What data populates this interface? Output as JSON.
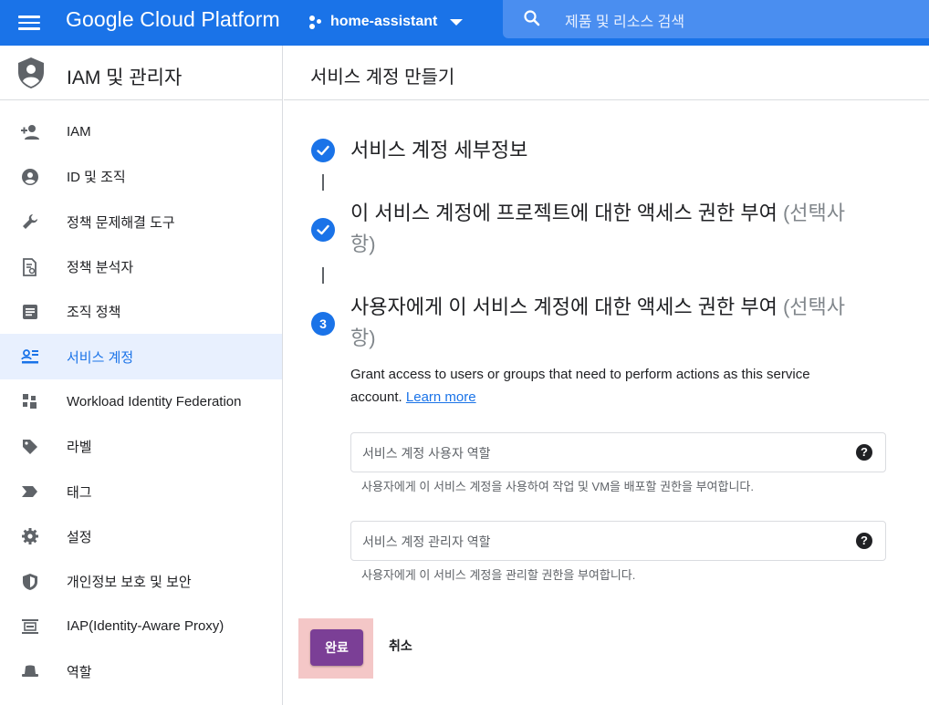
{
  "topbar": {
    "brand": "Google Cloud Platform",
    "project": "home-assistant",
    "search_placeholder": "제품 및 리소스 검색",
    "accent_color": "#1a73e8"
  },
  "sidebar": {
    "title": "IAM 및 관리자",
    "items": [
      {
        "label": "IAM",
        "icon": "person-add-icon",
        "active": false
      },
      {
        "label": "ID 및 조직",
        "icon": "account-circle-icon",
        "active": false
      },
      {
        "label": "정책 문제해결 도구",
        "icon": "wrench-icon",
        "active": false
      },
      {
        "label": "정책 분석자",
        "icon": "document-search-icon",
        "active": false
      },
      {
        "label": "조직 정책",
        "icon": "list-document-icon",
        "active": false
      },
      {
        "label": "서비스 계정",
        "icon": "service-account-icon",
        "active": true
      },
      {
        "label": "Workload Identity Federation",
        "icon": "grid-blocks-icon",
        "active": false
      },
      {
        "label": "라벨",
        "icon": "label-tag-icon",
        "active": false
      },
      {
        "label": "태그",
        "icon": "arrow-tag-icon",
        "active": false
      },
      {
        "label": "설정",
        "icon": "gear-icon",
        "active": false
      },
      {
        "label": "개인정보 보호 및 보안",
        "icon": "shield-icon",
        "active": false
      },
      {
        "label": "IAP(Identity-Aware Proxy)",
        "icon": "iap-icon",
        "active": false
      },
      {
        "label": "역할",
        "icon": "hat-icon",
        "active": false
      }
    ]
  },
  "main": {
    "title": "서비스 계정 만들기",
    "steps": [
      {
        "title": "서비스 계정 세부정보",
        "optional": "",
        "status": "done"
      },
      {
        "title_line1": "이 서비스 계정에 프로젝트에 대한 액세스 권한 부여",
        "optional_line1": "(선택사",
        "optional_line2": "항)",
        "status": "done"
      },
      {
        "number": "3",
        "title_line1": "사용자에게 이 서비스 계정에 대한 액세스 권한 부여",
        "optional_line1": "(선택사",
        "optional_line2": "항)",
        "status": "current"
      }
    ],
    "description_line1": "Grant access to users or groups that need to perform actions as this service",
    "description_line2": "account.",
    "learn_more": "Learn more",
    "fields": [
      {
        "placeholder": "서비스 계정 사용자 역할",
        "hint": "사용자에게 이 서비스 계정을 사용하여 작업 및 VM을 배포할 권한을 부여합니다."
      },
      {
        "placeholder": "서비스 계정 관리자 역할",
        "hint": "사용자에게 이 서비스 계정을 관리할 권한을 부여합니다."
      }
    ],
    "done_label": "완료",
    "cancel_label": "취소",
    "done_button_color": "#7b3f96",
    "highlight_color": "#f4c7c7"
  }
}
